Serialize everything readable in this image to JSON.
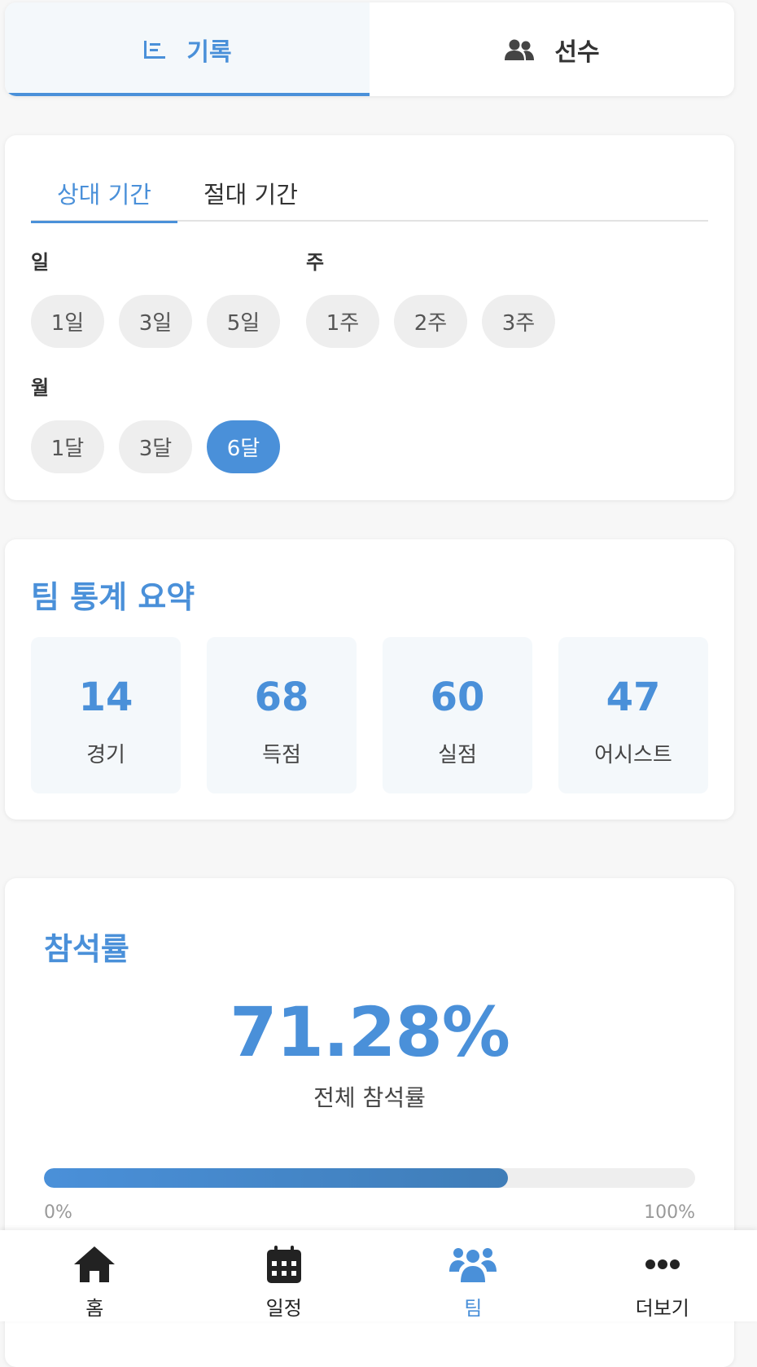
{
  "top_tabs": [
    {
      "label": "기록",
      "icon": "bar-chart-icon",
      "active": true
    },
    {
      "label": "선수",
      "icon": "users-icon",
      "active": false
    }
  ],
  "period": {
    "tabs": [
      {
        "label": "상대 기간",
        "active": true
      },
      {
        "label": "절대 기간",
        "active": false
      }
    ],
    "groups": {
      "day": {
        "label": "일",
        "options": [
          "1일",
          "3일",
          "5일"
        ]
      },
      "week": {
        "label": "주",
        "options": [
          "1주",
          "2주",
          "3주"
        ]
      },
      "month": {
        "label": "월",
        "options": [
          "1달",
          "3달",
          "6달"
        ]
      }
    },
    "selected": "6달"
  },
  "summary": {
    "title": "팀 통계 요약",
    "stats": [
      {
        "value": "14",
        "label": "경기"
      },
      {
        "value": "68",
        "label": "득점"
      },
      {
        "value": "60",
        "label": "실점"
      },
      {
        "value": "47",
        "label": "어시스트"
      }
    ]
  },
  "attendance": {
    "title": "참석률",
    "rate_text": "71.28%",
    "rate_value": 71.28,
    "label": "전체 참석률",
    "min_label": "0%",
    "max_label": "100%"
  },
  "bottom_nav": [
    {
      "label": "홈",
      "icon": "home-icon",
      "active": false
    },
    {
      "label": "일정",
      "icon": "calendar-icon",
      "active": false
    },
    {
      "label": "팀",
      "icon": "team-icon",
      "active": true
    },
    {
      "label": "더보기",
      "icon": "more-icon",
      "active": false
    }
  ],
  "colors": {
    "accent": "#4a90d9",
    "pill": "#eeeeee",
    "card_tint": "#f4f8fb"
  }
}
